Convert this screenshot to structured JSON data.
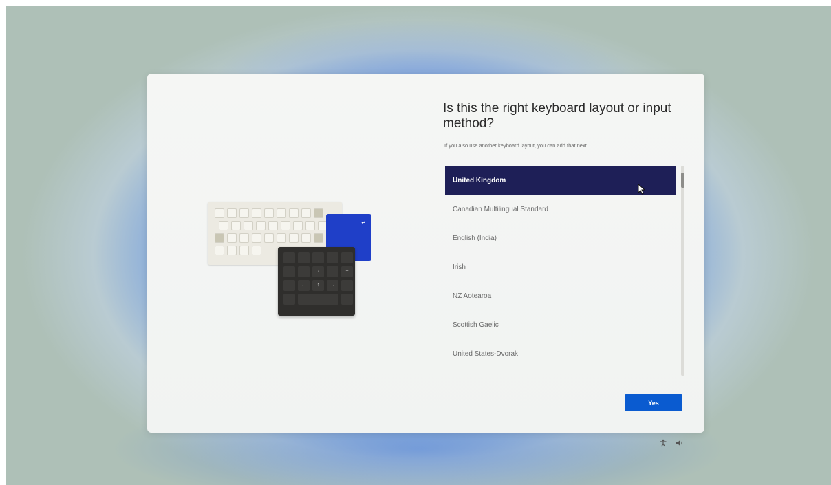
{
  "dialog": {
    "title": "Is this the right keyboard layout or input method?",
    "subtitle": "If you also use another keyboard layout, you can add that next.",
    "yes_label": "Yes"
  },
  "layouts": [
    "United Kingdom",
    "Canadian Multilingual Standard",
    "English (India)",
    "Irish",
    "NZ Aotearoa",
    "Scottish Gaelic",
    "United States-Dvorak"
  ],
  "selected_index": 0,
  "icons": {
    "accessibility": "accessibility-icon",
    "volume": "volume-icon",
    "cursor": "mouse-cursor-icon"
  },
  "colors": {
    "selected_bg": "#1e1f57",
    "button_bg": "#0a5bd0"
  }
}
